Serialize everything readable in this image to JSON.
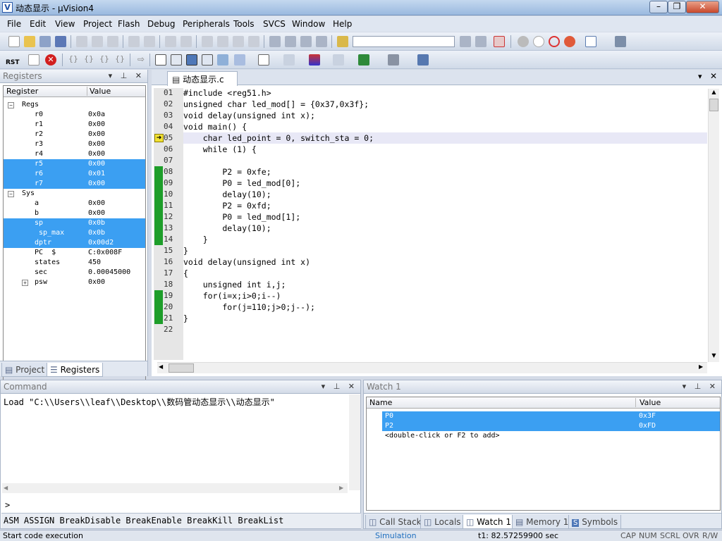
{
  "window": {
    "title": "动态显示 - μVision4"
  },
  "menu": [
    "File",
    "Edit",
    "View",
    "Project",
    "Flash",
    "Debug",
    "Peripherals",
    "Tools",
    "SVCS",
    "Window",
    "Help"
  ],
  "registers": {
    "title": "Registers",
    "col_register": "Register",
    "col_value": "Value",
    "rows": [
      {
        "name": "Regs",
        "value": ""
      },
      {
        "name": "r0",
        "value": "0x0a"
      },
      {
        "name": "r1",
        "value": "0x00"
      },
      {
        "name": "r2",
        "value": "0x00"
      },
      {
        "name": "r3",
        "value": "0x00"
      },
      {
        "name": "r4",
        "value": "0x00"
      },
      {
        "name": "r5",
        "value": "0x00"
      },
      {
        "name": "r6",
        "value": "0x01"
      },
      {
        "name": "r7",
        "value": "0x00"
      },
      {
        "name": "Sys",
        "value": ""
      },
      {
        "name": "a",
        "value": "0x00"
      },
      {
        "name": "b",
        "value": "0x00"
      },
      {
        "name": "sp",
        "value": "0x0b"
      },
      {
        "name": "sp_max",
        "value": "0x0b"
      },
      {
        "name": "dptr",
        "value": "0x00d2"
      },
      {
        "name": "PC  $",
        "value": "C:0x008F"
      },
      {
        "name": "states",
        "value": "450"
      },
      {
        "name": "sec",
        "value": "0.00045000"
      },
      {
        "name": "psw",
        "value": "0x00"
      }
    ],
    "tabs": [
      "Project",
      "Registers"
    ]
  },
  "editor": {
    "tab": "动态显示.c",
    "lines": [
      {
        "n": "01",
        "text": "#include <reg51.h>"
      },
      {
        "n": "02",
        "text": "unsigned char led_mod[] = {0x37,0x3f};"
      },
      {
        "n": "03",
        "text": "void delay(unsigned int x);"
      },
      {
        "n": "04",
        "text": "void main() {"
      },
      {
        "n": "05",
        "text": "    char led_point = 0, switch_sta = 0;"
      },
      {
        "n": "06",
        "text": "    while (1) {"
      },
      {
        "n": "07",
        "text": ""
      },
      {
        "n": "08",
        "text": "        P2 = 0xfe;"
      },
      {
        "n": "09",
        "text": "        P0 = led_mod[0];"
      },
      {
        "n": "10",
        "text": "        delay(10);"
      },
      {
        "n": "11",
        "text": "        P2 = 0xfd;"
      },
      {
        "n": "12",
        "text": "        P0 = led_mod[1];"
      },
      {
        "n": "13",
        "text": "        delay(10);"
      },
      {
        "n": "14",
        "text": "    }"
      },
      {
        "n": "15",
        "text": "}"
      },
      {
        "n": "16",
        "text": "void delay(unsigned int x)"
      },
      {
        "n": "17",
        "text": "{"
      },
      {
        "n": "18",
        "text": "    unsigned int i,j;"
      },
      {
        "n": "19",
        "text": "    for(i=x;i>0;i--)"
      },
      {
        "n": "20",
        "text": "        for(j=110;j>0;j--);"
      },
      {
        "n": "21",
        "text": "}"
      },
      {
        "n": "22",
        "text": ""
      }
    ]
  },
  "command": {
    "title": "Command",
    "output": "Load \"C:\\\\Users\\\\leaf\\\\Desktop\\\\数码管动态显示\\\\动态显示\"",
    "prompt": ">",
    "hint": "ASM ASSIGN BreakDisable BreakEnable BreakKill BreakList"
  },
  "watch": {
    "title": "Watch 1",
    "col_name": "Name",
    "col_value": "Value",
    "rows": [
      {
        "name": "P0",
        "value": "0x3F"
      },
      {
        "name": "P2",
        "value": "0xFD"
      },
      {
        "name": "<double-click or F2 to add>",
        "value": ""
      }
    ],
    "tabs": [
      "Call Stack",
      "Locals",
      "Watch 1",
      "Memory 1",
      "Symbols"
    ]
  },
  "status": {
    "left": "Start code execution",
    "mode": "Simulation",
    "time": "t1: 82.57259900 sec",
    "flags": [
      "CAP",
      "NUM",
      "SCRL",
      "OVR",
      "R/W"
    ]
  },
  "colors": {
    "selection": "#3b9ff2",
    "green_bar": "#1e9e2a",
    "simulation": "#2070c0"
  },
  "toolbar": {
    "rst_label": "RST"
  }
}
